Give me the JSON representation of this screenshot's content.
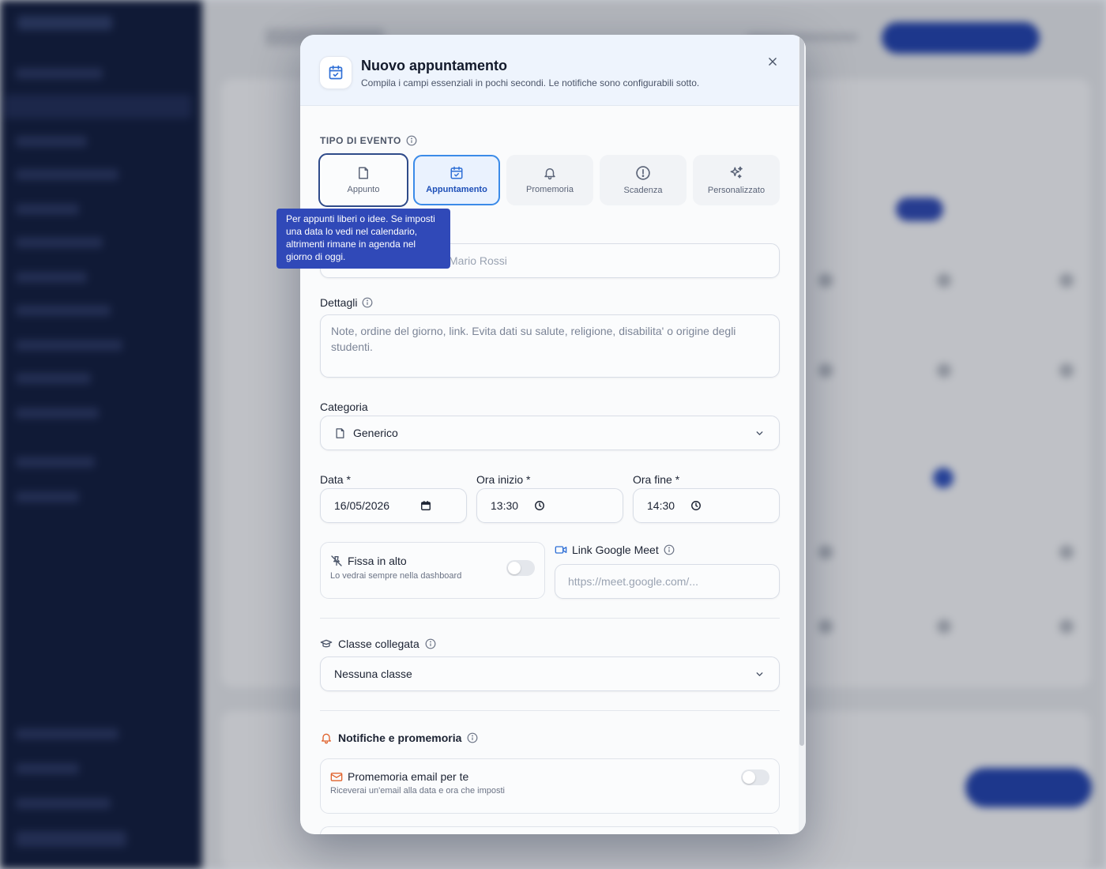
{
  "modal": {
    "title": "Nuovo appuntamento",
    "subtitle": "Compila i campi essenziali in pochi secondi. Le notifiche sono configurabili sotto.",
    "close_icon": "close-icon",
    "header_icon": "calendar-check-icon"
  },
  "event_type": {
    "label": "TIPO DI EVENTO",
    "options": [
      {
        "label": "Appunto",
        "icon": "note-icon",
        "state": "focused"
      },
      {
        "label": "Appuntamento",
        "icon": "calendar-check-icon",
        "state": "selected"
      },
      {
        "label": "Promemoria",
        "icon": "bell-icon",
        "state": "default"
      },
      {
        "label": "Scadenza",
        "icon": "alert-circle-icon",
        "state": "default"
      },
      {
        "label": "Personalizzato",
        "icon": "sparkles-icon",
        "state": "default"
      }
    ],
    "tooltip": "Per appunti liberi o idee. Se imposti una data lo vedi nel calendario, altrimenti rimane in agenda nel giorno di oggi."
  },
  "title_field": {
    "placeholder_visible": "Mario Rossi"
  },
  "details": {
    "label": "Dettagli",
    "placeholder": "Note, ordine del giorno, link. Evita dati su salute, religione, disabilita' o origine degli studenti."
  },
  "category": {
    "label": "Categoria",
    "value": "Generico"
  },
  "date": {
    "label": "Data *",
    "value": "16/05/2026"
  },
  "start_time": {
    "label": "Ora inizio *",
    "value": "13:30"
  },
  "end_time": {
    "label": "Ora fine *",
    "value": "14:30"
  },
  "pin": {
    "title": "Fissa in alto",
    "subtitle": "Lo vedrai sempre nella dashboard",
    "enabled": false
  },
  "meet": {
    "label": "Link Google Meet",
    "placeholder": "https://meet.google.com/..."
  },
  "linked_class": {
    "label": "Classe collegata",
    "value": "Nessuna classe"
  },
  "notifications": {
    "label": "Notifiche e promemoria",
    "email_reminder": {
      "title": "Promemoria email per te",
      "subtitle": "Riceverai un'email alla data e ora che imposti",
      "enabled": false
    }
  },
  "colors": {
    "accent": "#3b8be8",
    "selected_text": "#1d4fb8",
    "tooltip_bg": "#3049b8",
    "notification_accent": "#e0622b"
  }
}
